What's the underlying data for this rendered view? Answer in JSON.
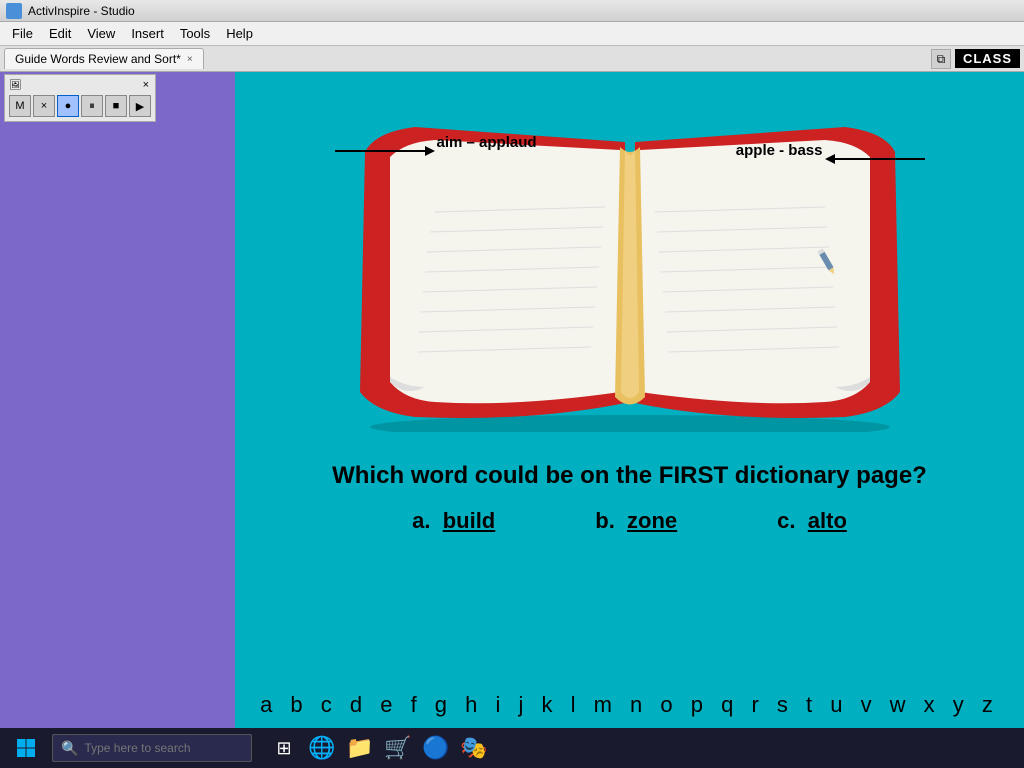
{
  "titlebar": {
    "app_name": "ActivInspire - Studio"
  },
  "menubar": {
    "items": [
      "File",
      "Edit",
      "View",
      "Insert",
      "Tools",
      "Help"
    ]
  },
  "tab": {
    "label": "Guide Words Review and Sort*",
    "close_label": "×"
  },
  "class_badge": "CLASS",
  "toolbar": {
    "close": "×",
    "buttons": [
      "M",
      "×",
      "●",
      "▐▐",
      "■",
      "▶"
    ]
  },
  "book": {
    "guide_word_left": "aim – applaud",
    "guide_word_right": "apple - bass"
  },
  "question": {
    "text": "Which word could be on the FIRST dictionary page?",
    "answers": [
      {
        "label": "a.",
        "word": "build"
      },
      {
        "label": "b.",
        "word": "zone"
      },
      {
        "label": "c.",
        "word": "alto"
      }
    ]
  },
  "alphabet": "a b c d e f g h i j k l m n o p q r s t u v w x y z",
  "taskbar": {
    "search_placeholder": "Type here to search",
    "icons": [
      "🌐",
      "📁",
      "🛒",
      "⚙",
      "🎭"
    ]
  }
}
